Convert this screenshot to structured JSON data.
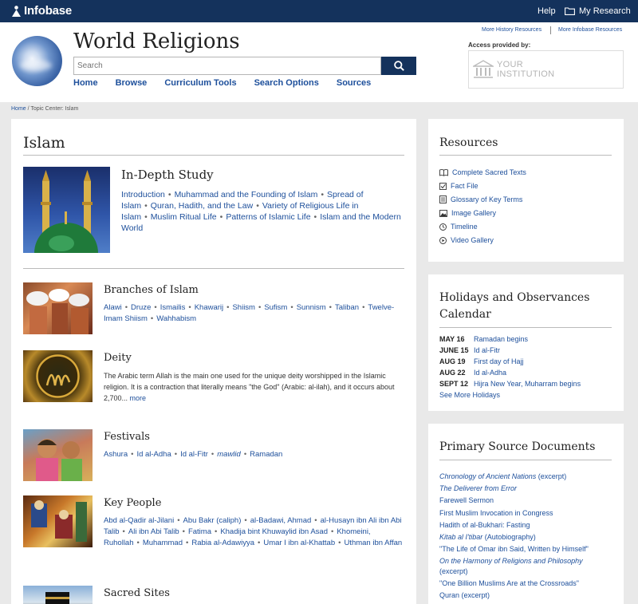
{
  "topbar": {
    "logo": "Infobase",
    "help": "Help",
    "my_research": "My Research"
  },
  "header": {
    "title": "World Religions",
    "search_placeholder": "Search",
    "nav": [
      "Home",
      "Browse",
      "Curriculum Tools",
      "Search Options",
      "Sources"
    ],
    "more_history": "More History Resources",
    "more_infobase": "More Infobase Resources",
    "access": "Access provided by:",
    "institution_line1": "YOUR",
    "institution_line2": "INSTITUTION"
  },
  "breadcrumb": {
    "home": "Home",
    "current": " / Topic Center: Islam"
  },
  "main": {
    "title": "Islam",
    "indepth": {
      "title": "In-Depth Study",
      "links": [
        "Introduction",
        "Muhammad and the Founding of Islam",
        "Spread of Islam",
        "Quran, Hadith, and the Law",
        "Variety of Religious Life in Islam",
        "Muslim Ritual Life",
        "Patterns of Islamic Life",
        "Islam and the Modern World"
      ]
    },
    "branches": {
      "title": "Branches of Islam",
      "links": [
        "Alawi",
        "Druze",
        "Ismailis",
        "Khawarij",
        "Shiism",
        "Sufism",
        "Sunnism",
        "Taliban",
        "Twelve-Imam Shiism",
        "Wahhabism"
      ]
    },
    "deity": {
      "title": "Deity",
      "text": "The Arabic term Allah is the main one used for the unique deity worshipped in the Islamic religion. It is a contraction that literally means \"the God\" (Arabic: al-ilah), and it occurs about 2,700...",
      "more": "more"
    },
    "festivals": {
      "title": "Festivals",
      "links": [
        "Ashura",
        "Id al-Adha",
        "Id al-Fitr",
        "mawlid",
        "Ramadan"
      ]
    },
    "keypeople": {
      "title": "Key People",
      "links": [
        "Abd al-Qadir al-Jilani",
        "Abu Bakr (caliph)",
        "al-Badawi, Ahmad",
        "al-Husayn ibn Ali ibn Abi Talib",
        "Ali ibn Abi Talib",
        "Fatima",
        "Khadija bint Khuwaylid ibn Asad",
        "Khomeini, Ruhollah",
        "Muhammad",
        "Rabia al-Adawiyya",
        "Umar I ibn al-Khattab",
        "Uthman ibn Affan"
      ]
    },
    "sacredsites": {
      "title": "Sacred Sites"
    }
  },
  "resources": {
    "title": "Resources",
    "items": [
      {
        "label": "Complete Sacred Texts",
        "icon": "book-icon"
      },
      {
        "label": "Fact File",
        "icon": "checkbox-icon"
      },
      {
        "label": "Glossary of Key Terms",
        "icon": "document-icon"
      },
      {
        "label": "Image Gallery",
        "icon": "image-icon"
      },
      {
        "label": "Timeline",
        "icon": "clock-icon"
      },
      {
        "label": "Video Gallery",
        "icon": "play-icon"
      }
    ]
  },
  "holidays": {
    "title": "Holidays and Observances Calendar",
    "items": [
      {
        "date": "MAY 16",
        "name": "Ramadan begins"
      },
      {
        "date": "JUNE 15",
        "name": "Id al-Fitr"
      },
      {
        "date": "AUG 19",
        "name": "First day of Hajj"
      },
      {
        "date": "AUG 22",
        "name": "Id al-Adha"
      },
      {
        "date": "SEPT 12",
        "name": "Hijra New Year, Muharram begins"
      }
    ],
    "see_more": "See More Holidays"
  },
  "primary_sources": {
    "title": "Primary Source Documents",
    "items": [
      {
        "italic": "Chronology of Ancient Nations",
        "plain": " (excerpt)"
      },
      {
        "italic": "The Deliverer from Error",
        "plain": ""
      },
      {
        "italic": "",
        "plain": "Farewell Sermon"
      },
      {
        "italic": "",
        "plain": "First Muslim Invocation in Congress"
      },
      {
        "italic": "",
        "plain": "Hadith of al-Bukhari: Fasting"
      },
      {
        "italic": "Kitab al I'tibar",
        "plain": " (Autobiography)"
      },
      {
        "italic": "",
        "plain": "\"The Life of Omar ibn Said, Written by Himself\""
      },
      {
        "italic": "On the Harmony of Religions and Philosophy",
        "plain": " (excerpt)"
      },
      {
        "italic": "",
        "plain": "\"One Billion Muslims Are at the Crossroads\""
      },
      {
        "italic": "",
        "plain": "Quran (excerpt)"
      }
    ]
  },
  "colors": {
    "navy": "#14325c",
    "link": "#1d4f9b",
    "background": "#e9e9e9"
  }
}
